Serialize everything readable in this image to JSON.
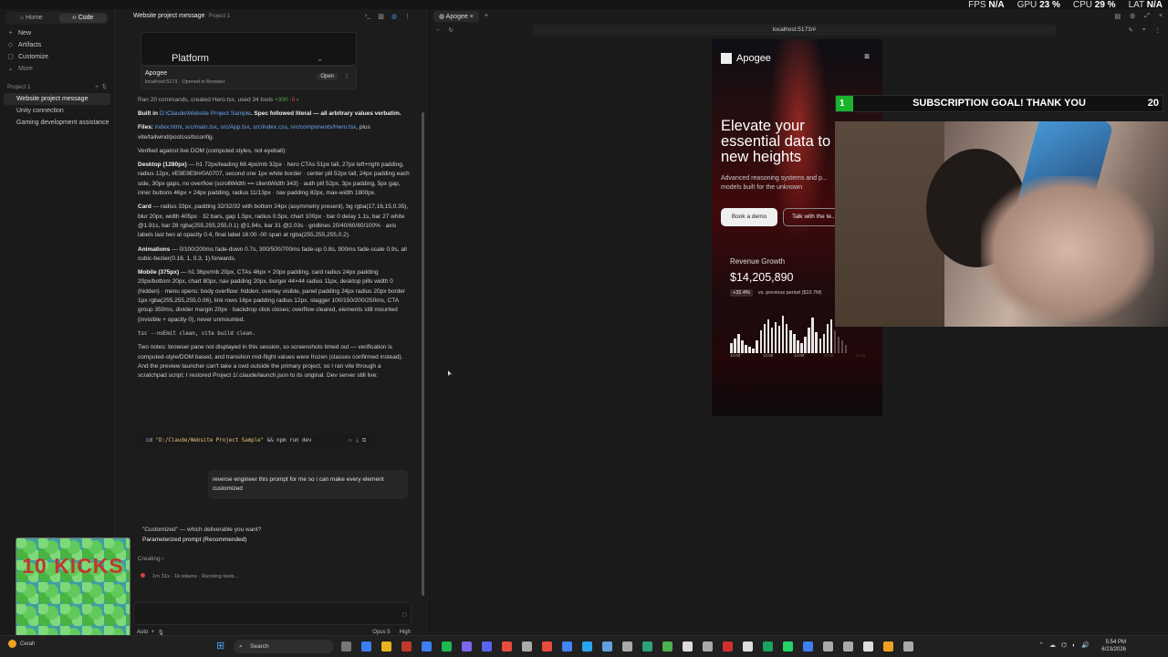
{
  "stats": {
    "fps_label": "FPS",
    "fps": "N/A",
    "gpu_label": "GPU",
    "gpu": "23 %",
    "cpu_label": "CPU",
    "cpu": "29 %",
    "lat_label": "LAT",
    "lat": "N/A"
  },
  "nav": {
    "home": "Home",
    "code": "Code",
    "items": [
      {
        "icon": "plus-icon",
        "label": "New"
      },
      {
        "icon": "artifacts-icon",
        "label": "Artifacts"
      },
      {
        "icon": "customize-icon",
        "label": "Customize"
      },
      {
        "icon": "chevron-down-icon",
        "label": "More"
      }
    ],
    "section": "Project 1",
    "projects": [
      "Website project message",
      "Unity connection",
      "Gaming development assistance"
    ]
  },
  "chat": {
    "title": "Website project message",
    "project": "Project 1",
    "platform_label": "Platform",
    "preview_name": "Apogee",
    "preview_sub": "localhost:5173 · Opened in Browser",
    "open": "Open",
    "ran": "Ran 20 commands, created Hero.tsx, used 34 tools",
    "ran_add": "+300",
    "ran_del": "-0",
    "built_prefix": "Built in",
    "built_path": "D:\\Claude\\Website Project Sample",
    "built_rest": ". Spec followed literal — all arbitrary values verbatim.",
    "files_label": "Files:",
    "files": [
      "index.html",
      "src/main.tsx",
      "src/App.tsx",
      "src/index.css",
      "src/components/Hero.tsx"
    ],
    "files_rest": ", plus vite/tailwind/postcss/tsconfig.",
    "verified": "Verified against live DOM (computed styles, not eyeball):",
    "desktop_label": "Desktop (1280px)",
    "desktop": " — h1 72px/leading 68.4px/mb 32px · hero CTAs 51px tall, 27px left+right padding, radius 12px, #E9E9E9/#0A0707, second one 1px white border · center pill 52px tall, 24px padding each side, 30px gaps, no overflow (scrollWidth == clientWidth 343) · auth pill 52px, 3px padding, 5px gap, inner buttons 46px × 24px padding, radius 11/13px · nav padding 82px, max-width 1800px.",
    "card_label": "Card",
    "card": " — radius 33px, padding 32/32/32 with bottom 24px (asymmetry present), bg rgba(17,16,15,0.35), blur 20px, width 405px · 32 bars, gap 1.5px, radius 0.5px, chart 100px · bar 0 delay 1.1s, bar 27 white @1.91s, bar 28 rgba(255,255,255,0.1) @1.94s, bar 31 @2.03s · gridlines 20/40/60/80/100% · axis labels last two at opacity 0.4, final label 16:00 -00 span at rgba(255,255,255,0.2).",
    "anim_label": "Animations",
    "anim": " — 0/100/200ms fade-down 0.7s, 300/500/700ms fade-up 0.8s, 900ms fade-scale 0.9s, all cubic-bezier(0.16, 1, 0.3, 1) forwards.",
    "mobile_label": "Mobile (375px)",
    "mobile": " — h1 36px/mb 20px, CTAs 46px × 20px padding, card radius 24px padding 20px/bottom 20px, chart 80px, nav padding 20px, burger 44×44 radius 11px, desktop pills width 0 (hidden) · menu opens: body overflow: hidden, overlay visible, panel padding 24px radius 20px border 1px rgba(255,255,255,0.06), link rows 16px padding radius 12px, stagger 100/150/200/250ms, CTA group 350ms, divider margin 20px · backdrop click closes; overflow cleared, elements still mounted (invisible + opacity-0), never unmounted.",
    "tsc": "tsc --noEmit clean, vite build clean.",
    "notes": "Two notes: browser pane not displayed in this session, so screenshots timed out — verification is computed-style/DOM based, and transition mid-flight values were frozen (classes confirmed instead). And the preview launcher can't take a cwd outside the primary project, so I ran vite through a scratchpad script; I restored Project 1/.claude/launch.json to its original. Dev server still live:",
    "cmd_pre": "cd ",
    "cmd_path": "\"D:/Claude/Website Project Sample\"",
    "cmd_post": " && npm run dev",
    "user_msg": "reverse engineer this prompt for me so i can make every element customized",
    "q1": "\"Customized\" — which deliverable you want?",
    "q2": "Parameterized prompt (Recommended)",
    "creating": "Creating",
    "running": "1m 31s · 1k tokens · Running tools...",
    "input_mode": "Auto",
    "model": "Opus 5",
    "effort": "High"
  },
  "overlay": {
    "kicks": "10 KICKS",
    "goal_num": "1",
    "goal_text": "SUBSCRIPTION GOAL! THANK YOU",
    "goal_target": "20"
  },
  "browser": {
    "tab": "Apogee",
    "url": "localhost:5173/#",
    "site": {
      "brand": "Apogee",
      "headline": "Elevate your essential data to new heights",
      "sub": "Advanced reasoning systems and p... models built for the unknown",
      "btn1": "Book a demo",
      "btn2": "Talk with the te...",
      "rev_label": "Revenue Growth",
      "rev_value": "$14,205,890",
      "rev_pct": "+32.4%",
      "rev_prev": "vs. previous period ($10.7M)",
      "ticks": [
        "10:00",
        "12:00",
        "14:00",
        "16:00",
        "16:00"
      ],
      "bars": [
        0.25,
        0.35,
        0.45,
        0.3,
        0.2,
        0.15,
        0.1,
        0.3,
        0.55,
        0.7,
        0.8,
        0.6,
        0.75,
        0.65,
        0.9,
        0.7,
        0.55,
        0.45,
        0.3,
        0.25,
        0.4,
        0.6,
        0.85,
        0.5,
        0.35,
        0.45,
        0.7,
        0.8,
        0.55,
        0.4,
        0.3,
        0.2
      ]
    }
  },
  "taskbar": {
    "weather": "Cerah",
    "search": "Search",
    "time": "5:54 PM",
    "date": "6/23/2026"
  }
}
